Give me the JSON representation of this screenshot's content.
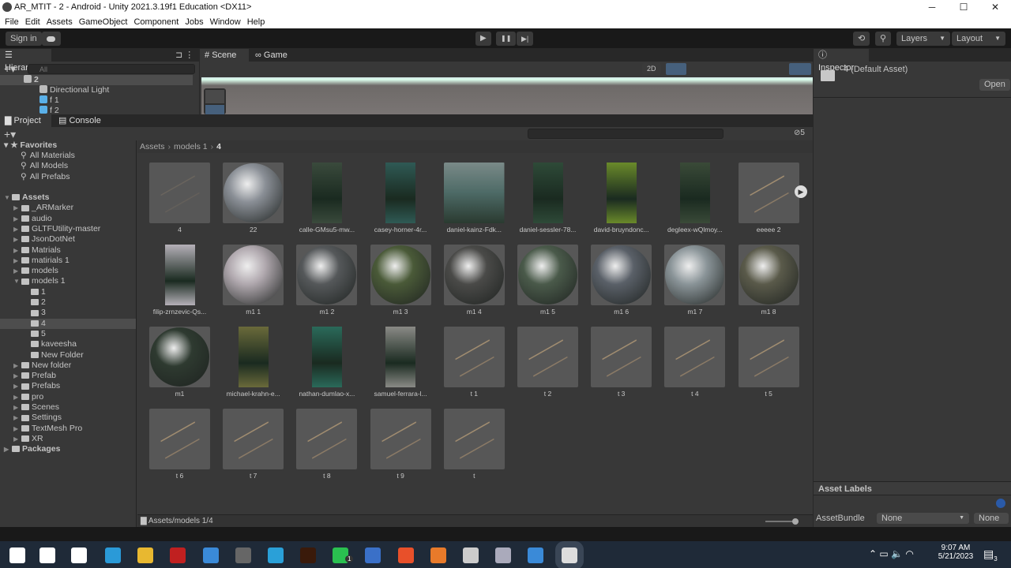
{
  "window": {
    "title": "AR_MTIT - 2 - Android - Unity 2021.3.19f1 Education <DX11>",
    "minimize": "─",
    "maximize": "☐",
    "close": "✕"
  },
  "menu": [
    "File",
    "Edit",
    "Assets",
    "GameObject",
    "Component",
    "Jobs",
    "Window",
    "Help"
  ],
  "toolbar": {
    "sign_in": "Sign in",
    "play": "▶",
    "pause": "❚❚",
    "step": "▶|",
    "layers": "Layers",
    "layout": "Layout"
  },
  "hierarchy": {
    "tab": "Hierarchy",
    "search_placeholder": "All",
    "items": [
      {
        "label": "2",
        "depth": 0
      },
      {
        "label": "Directional Light",
        "depth": 1
      },
      {
        "label": "f 1",
        "depth": 1
      },
      {
        "label": "f 2",
        "depth": 1
      }
    ]
  },
  "scene": {
    "tabs": [
      "Scene",
      "Game"
    ],
    "mode_2d": "2D"
  },
  "project": {
    "tabs": [
      "Project",
      "Console"
    ],
    "hidden_count": "5",
    "favorites": {
      "label": "Favorites",
      "items": [
        "All Materials",
        "All Models",
        "All Prefabs"
      ]
    },
    "tree": [
      {
        "label": "Assets",
        "depth": 0
      },
      {
        "label": "_ARMarker",
        "depth": 1
      },
      {
        "label": "audio",
        "depth": 1
      },
      {
        "label": "GLTFUtility-master",
        "depth": 1
      },
      {
        "label": "JsonDotNet",
        "depth": 1
      },
      {
        "label": "Matrials",
        "depth": 1
      },
      {
        "label": "matirials 1",
        "depth": 1
      },
      {
        "label": "models",
        "depth": 1
      },
      {
        "label": "models 1",
        "depth": 1
      },
      {
        "label": "1",
        "depth": 2
      },
      {
        "label": "2",
        "depth": 2
      },
      {
        "label": "3",
        "depth": 2
      },
      {
        "label": "4",
        "depth": 2,
        "selected": true
      },
      {
        "label": "5",
        "depth": 2
      },
      {
        "label": "kaveesha",
        "depth": 2
      },
      {
        "label": "New Folder",
        "depth": 2
      },
      {
        "label": "New folder",
        "depth": 1
      },
      {
        "label": "Prefab",
        "depth": 1
      },
      {
        "label": "Prefabs",
        "depth": 1
      },
      {
        "label": "pro",
        "depth": 1
      },
      {
        "label": "Scenes",
        "depth": 1
      },
      {
        "label": "Settings",
        "depth": 1
      },
      {
        "label": "TextMesh Pro",
        "depth": 1
      },
      {
        "label": "XR",
        "depth": 1
      },
      {
        "label": "Packages",
        "depth": 0
      }
    ],
    "breadcrumb": [
      "Assets",
      "models 1",
      "4"
    ],
    "assets": [
      {
        "name": "4",
        "kind": "model-faint"
      },
      {
        "name": "22",
        "kind": "sphere",
        "color": "#8a8f96"
      },
      {
        "name": "calle-GMsu5-mw...",
        "kind": "photo",
        "color": "#3a4a3c"
      },
      {
        "name": "casey-horner-4r...",
        "kind": "photo",
        "color": "#2f5a55"
      },
      {
        "name": "daniel-kainz-Fdk...",
        "kind": "photo-wide",
        "color": "#4d6a66"
      },
      {
        "name": "daniel-sessler-78...",
        "kind": "photo",
        "color": "#2e4a38"
      },
      {
        "name": "david-bruyndonc...",
        "kind": "photo",
        "color": "#6a8a2a"
      },
      {
        "name": "degleex-wQlmoy...",
        "kind": "photo",
        "color": "#3a4a38"
      },
      {
        "name": "eeeee 2",
        "kind": "model"
      },
      {
        "name": "filip-zrnzevic-Qs...",
        "kind": "photo",
        "color": "#b5b0b8"
      },
      {
        "name": "m1 1",
        "kind": "sphere",
        "color": "#b0a8ae"
      },
      {
        "name": "m1 2",
        "kind": "sphere",
        "color": "#55585a"
      },
      {
        "name": "m1 3",
        "kind": "sphere",
        "color": "#4a5a38"
      },
      {
        "name": "m1 4",
        "kind": "sphere",
        "color": "#4a4a48"
      },
      {
        "name": "m1 5",
        "kind": "sphere",
        "color": "#4a5a4a"
      },
      {
        "name": "m1 6",
        "kind": "sphere",
        "color": "#5a6068"
      },
      {
        "name": "m1 7",
        "kind": "sphere",
        "color": "#8a9498"
      },
      {
        "name": "m1 8",
        "kind": "sphere",
        "color": "#5a5a4a"
      },
      {
        "name": "m1",
        "kind": "sphere",
        "color": "#2e3a30"
      },
      {
        "name": "michael-krahn-e...",
        "kind": "photo",
        "color": "#6a6a3a"
      },
      {
        "name": "nathan-dumlao-x...",
        "kind": "photo",
        "color": "#2a6a5a"
      },
      {
        "name": "samuel-ferrara-l...",
        "kind": "photo",
        "color": "#8a8a86"
      },
      {
        "name": "t 1",
        "kind": "model"
      },
      {
        "name": "t 2",
        "kind": "model"
      },
      {
        "name": "t 3",
        "kind": "model"
      },
      {
        "name": "t 4",
        "kind": "model"
      },
      {
        "name": "t 5",
        "kind": "model"
      },
      {
        "name": "t 6",
        "kind": "model"
      },
      {
        "name": "t 7",
        "kind": "model"
      },
      {
        "name": "t 8",
        "kind": "model"
      },
      {
        "name": "t 9",
        "kind": "model"
      },
      {
        "name": "t",
        "kind": "model"
      }
    ],
    "status_path": "Assets/models 1/4"
  },
  "inspector": {
    "tab": "Inspector",
    "asset_title": "4 (Default Asset)",
    "open": "Open",
    "asset_labels": "Asset Labels",
    "assetbundle_label": "AssetBundle",
    "assetbundle_value": "None",
    "variant_value": "None"
  },
  "taskbar": {
    "time": "9:07 AM",
    "date": "5/21/2023",
    "notifications": "3",
    "whatsapp_badge": "1"
  }
}
